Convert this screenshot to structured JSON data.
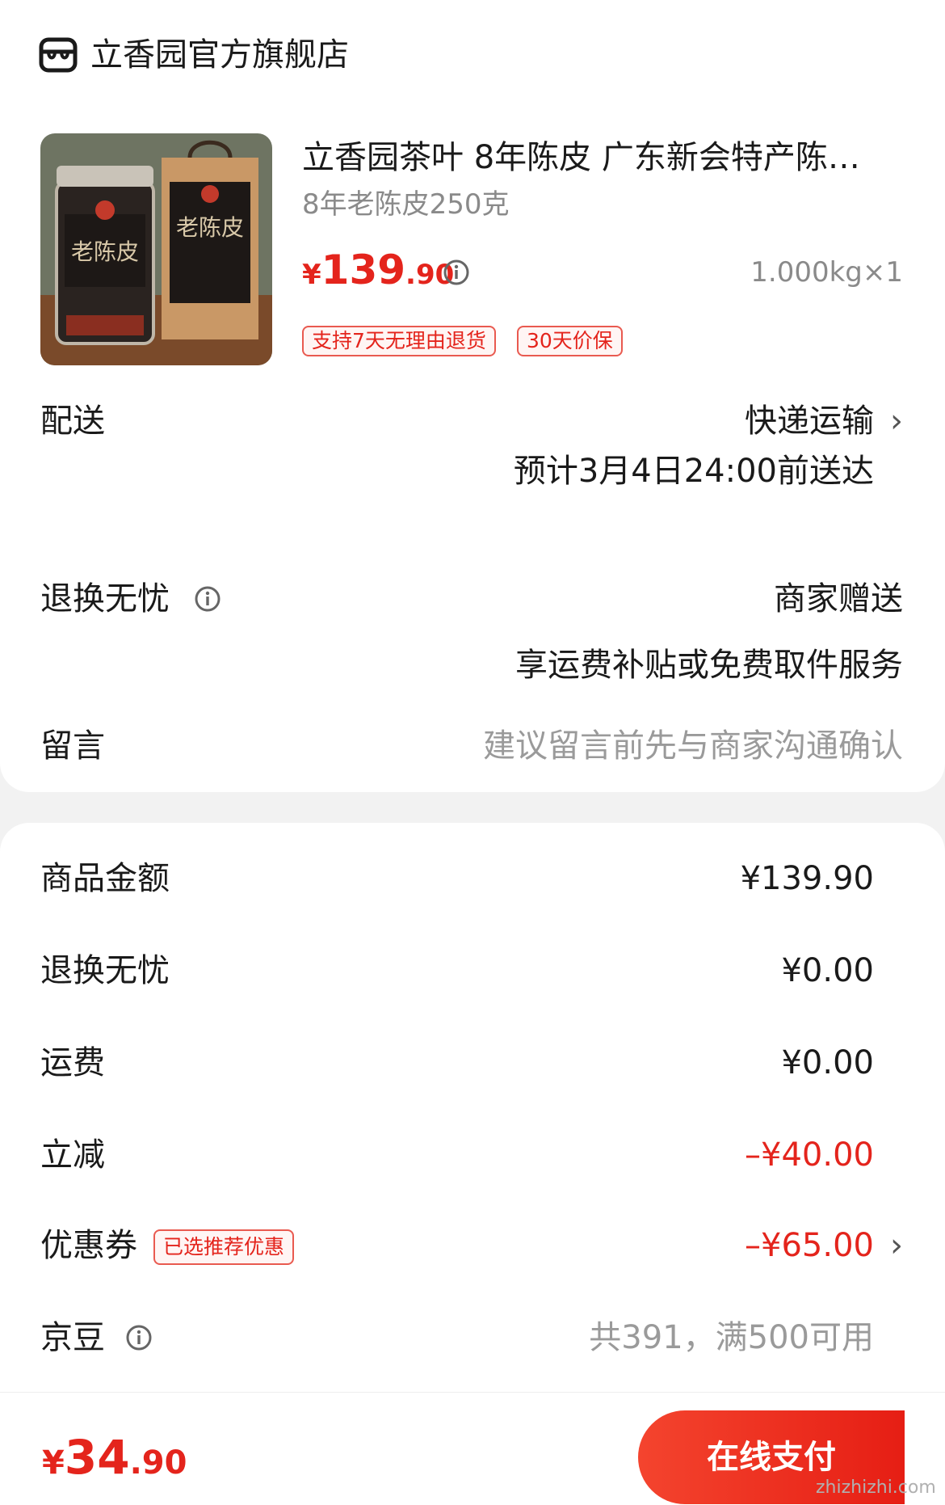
{
  "store": {
    "name": "立香园官方旗舰店",
    "icon": "store-icon"
  },
  "product": {
    "title": "立香园茶叶 8年陈皮 广东新会特产陈…",
    "spec": "8年老陈皮250克",
    "price_currency": "¥",
    "price_int": "139",
    "price_dec": ".90",
    "quantity": "1.000kg×1",
    "tags": [
      "支持7天无理由退货",
      "30天价保"
    ],
    "image_text": "老陈皮"
  },
  "delivery": {
    "label": "配送",
    "method": "快递运输",
    "estimate": "预计3月4日24:00前送达"
  },
  "returns": {
    "label": "退换无忧",
    "value": "商家赠送",
    "desc": "享运费补贴或免费取件服务"
  },
  "message": {
    "label": "留言",
    "placeholder": "建议留言前先与商家沟通确认"
  },
  "summary": {
    "rows": [
      {
        "label": "商品金额",
        "value": "¥139.90"
      },
      {
        "label": "退换无忧",
        "value": "¥0.00"
      },
      {
        "label": "运费",
        "value": "¥0.00"
      },
      {
        "label": "立减",
        "value": "–¥40.00"
      },
      {
        "label": "优惠券",
        "value": "–¥65.00",
        "tag": "已选推荐优惠"
      },
      {
        "label": "京豆",
        "value": "共391，满500可用"
      }
    ]
  },
  "footer": {
    "total_currency": "¥",
    "total_int": "34",
    "total_dec": ".90",
    "pay_label": "在线支付",
    "watermark": "zhizhizhi.com"
  },
  "colors": {
    "accent": "#e4241c",
    "pay_start": "#f4442e",
    "pay_end": "#e61e14"
  }
}
